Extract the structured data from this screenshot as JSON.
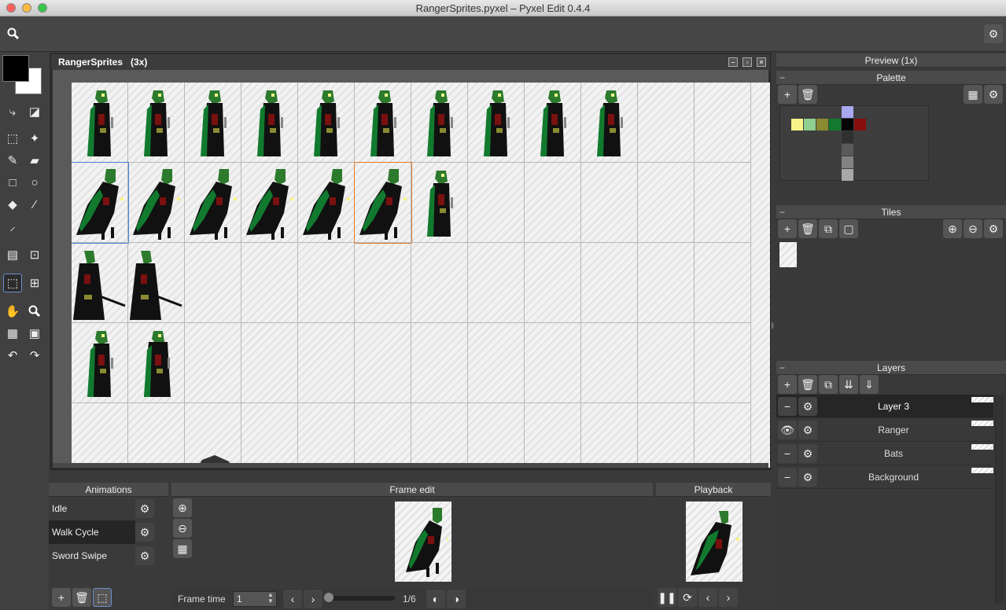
{
  "window": {
    "title": "RangerSprites.pyxel – Pyxel Edit 0.4.4"
  },
  "document": {
    "title": "RangerSprites",
    "zoom": "(3x)"
  },
  "panels": {
    "preview": {
      "title": "Preview (1x)"
    },
    "palette": {
      "title": "Palette",
      "colors": [
        "#f7f48a",
        "#8fcf8f",
        "#8a8a32",
        "#117a2e",
        "#050505",
        "#880e0e",
        "#a8a8f0",
        "#303030",
        "#5a5a5a",
        "#828282",
        "#a8a8a8"
      ]
    },
    "tiles": {
      "title": "Tiles"
    },
    "layers": {
      "title": "Layers",
      "items": [
        "Layer 3",
        "Ranger",
        "Bats",
        "Background"
      ],
      "selected": "Layer 3"
    },
    "animations": {
      "title": "Animations",
      "items": [
        "Idle",
        "Walk Cycle",
        "Sword Swipe"
      ],
      "selected": "Walk Cycle"
    },
    "frame_edit": {
      "title": "Frame edit",
      "frame_time_label": "Frame time",
      "frame_time_value": "1",
      "frame_counter": "1/6"
    },
    "playback": {
      "title": "Playback"
    }
  },
  "colors": {
    "primary": "#000000",
    "secondary": "#ffffff",
    "selection_blue": "#4a7fd0",
    "selection_orange": "#e07a2a",
    "panel_bg": "#393939"
  },
  "icons": [
    "search-icon",
    "gear-icon",
    "plus-icon",
    "trash-icon",
    "copy-icon",
    "zoom-in-icon",
    "zoom-out-icon",
    "pause-icon",
    "loop-icon",
    "chevron-left-icon",
    "chevron-right-icon",
    "eye-icon",
    "minus-icon",
    "hand-icon",
    "pencil-icon",
    "eraser-icon",
    "undo-icon",
    "redo-icon"
  ]
}
